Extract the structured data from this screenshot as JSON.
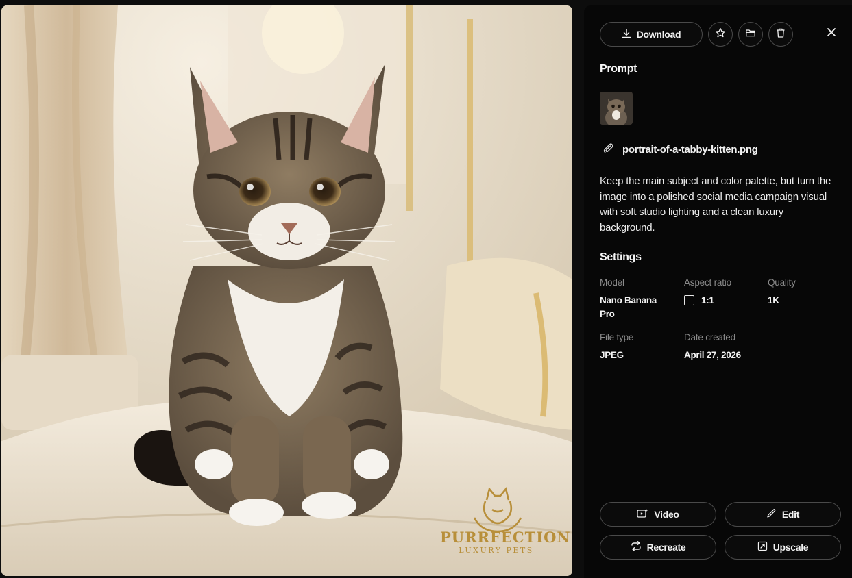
{
  "image": {
    "logo": {
      "title": "PURRFECTION",
      "subtitle": "LUXURY PETS"
    }
  },
  "toolbar": {
    "download_label": "Download",
    "icons": [
      "download-icon",
      "star-icon",
      "folder-icon",
      "trash-icon",
      "close-icon"
    ]
  },
  "prompt": {
    "heading": "Prompt",
    "attachment_name": "portrait-of-a-tabby-kitten.png",
    "text": "Keep the main subject and color palette, but turn the image into a polished social media campaign visual with soft studio lighting and a clean luxury background."
  },
  "settings": {
    "heading": "Settings",
    "model_label": "Model",
    "model_value": "Nano Banana Pro",
    "aspect_label": "Aspect ratio",
    "aspect_value": "1:1",
    "quality_label": "Quality",
    "quality_value": "1K",
    "filetype_label": "File type",
    "filetype_value": "JPEG",
    "date_label": "Date created",
    "date_value": "April 27, 2026"
  },
  "actions": {
    "video_label": "Video",
    "edit_label": "Edit",
    "recreate_label": "Recreate",
    "upscale_label": "Upscale"
  },
  "colors": {
    "panel_bg": "#070707",
    "border": "#4a4a4a",
    "muted_text": "#8a8a8a",
    "logo_gold": "#b88f3a"
  }
}
